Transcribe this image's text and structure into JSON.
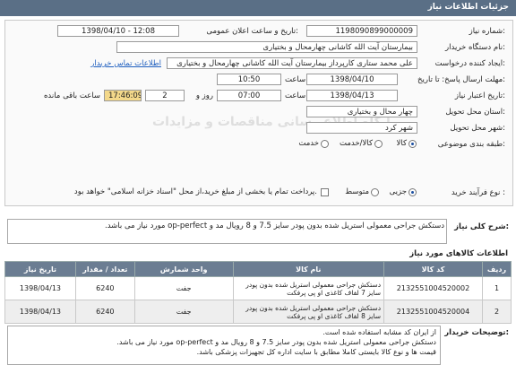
{
  "header": {
    "title": "جزئیات اطلاعات نیاز"
  },
  "fields": {
    "need_number": {
      "label": "شماره نیاز:",
      "value": "1198090899000009"
    },
    "announce_datetime": {
      "label": "تاریخ و ساعت اعلان عمومی:",
      "value": "1398/04/10 - 12:08"
    },
    "buyer_org": {
      "label": "نام دستگاه خریدار:",
      "value": "بیمارستان آیت الله کاشانی چهارمحال و بختیاری"
    },
    "creator": {
      "label": "ایجاد کننده درخواست:",
      "value": "علی محمد ستاری کارپرداز بیمارستان آیت الله کاشانی چهارمحال و بختیاری",
      "contact_link": "اطلاعات تماس خریدار"
    },
    "response_deadline": {
      "label": "مهلت ارسال پاسخ: تا تاریخ:",
      "date": "1398/04/10",
      "time_label": "ساعت",
      "time": "10:50"
    },
    "validity_deadline": {
      "label": "تاریخ اعتبار نیاز:",
      "date": "1398/04/13",
      "time_label": "ساعت",
      "time": "07:00",
      "days": "2",
      "days_label": "روز و",
      "remaining_time": "17:46:09",
      "remaining_label": "ساعت باقی مانده"
    },
    "delivery_province": {
      "label": "استان محل تحویل:",
      "value": "چهار محال و بختیاری"
    },
    "delivery_city": {
      "label": "شهر محل تحویل:",
      "value": "شهر کرد"
    },
    "category": {
      "label": "طبقه بندی موضوعی:",
      "options": [
        "کالا",
        "کالا/خدمت",
        "خدمت"
      ],
      "selected": "کالا"
    },
    "process_type": {
      "label": "نوع فرآیند خرید :",
      "options": [
        "جزیی",
        "متوسط"
      ],
      "selected": "جزیی",
      "payment_note": "پرداخت تمام یا بخشی از مبلغ خرید،از محل \"اسناد خزانه اسلامی\" خواهد بود."
    }
  },
  "description": {
    "label": "شرح کلی نیاز:",
    "text": "دستکش جراحی معمولی استریل شده بدون پودر سایز 7.5 و 8 رویال مد و op-perfect مورد نیاز می باشد."
  },
  "goods": {
    "title": "اطلاعات کالاهای مورد نیاز",
    "columns": [
      "ردیف",
      "کد کالا",
      "نام کالا",
      "واحد شمارش",
      "تعداد / مقدار",
      "تاریخ نیاز"
    ],
    "rows": [
      {
        "row": "1",
        "code": "2132551004520002",
        "name": "دستکش جراحی معمولی استریل شده بدون پودر سایز 7 لفاف کاغذی او پی پرفکت",
        "unit": "جفت",
        "qty": "6240",
        "date": "1398/04/13"
      },
      {
        "row": "2",
        "code": "2132551004520004",
        "name": "دستکش جراحی معمولی استریل شده بدون پودر سایز 8 لفاف کاغذی او پی پرفکت",
        "unit": "جفت",
        "qty": "6240",
        "date": "1398/04/13"
      }
    ]
  },
  "buyer_notes": {
    "label": "توضیحات خریدار:",
    "lines": [
      "از ایران کد مشابه استفاده شده است.",
      "دستکش جراحی معمولی استریل شده بدون پودر سایز 7.5 و 8 رویال مد و op-perfect مورد نیاز می باشد.",
      "قیمت ها و نوع کالا بایستی کاملا مطابق با سایت اداره کل تجهیزات پزشکی باشد."
    ]
  },
  "watermark": "پایگاه اطلاع رسانی مناقصات و مزایدات"
}
